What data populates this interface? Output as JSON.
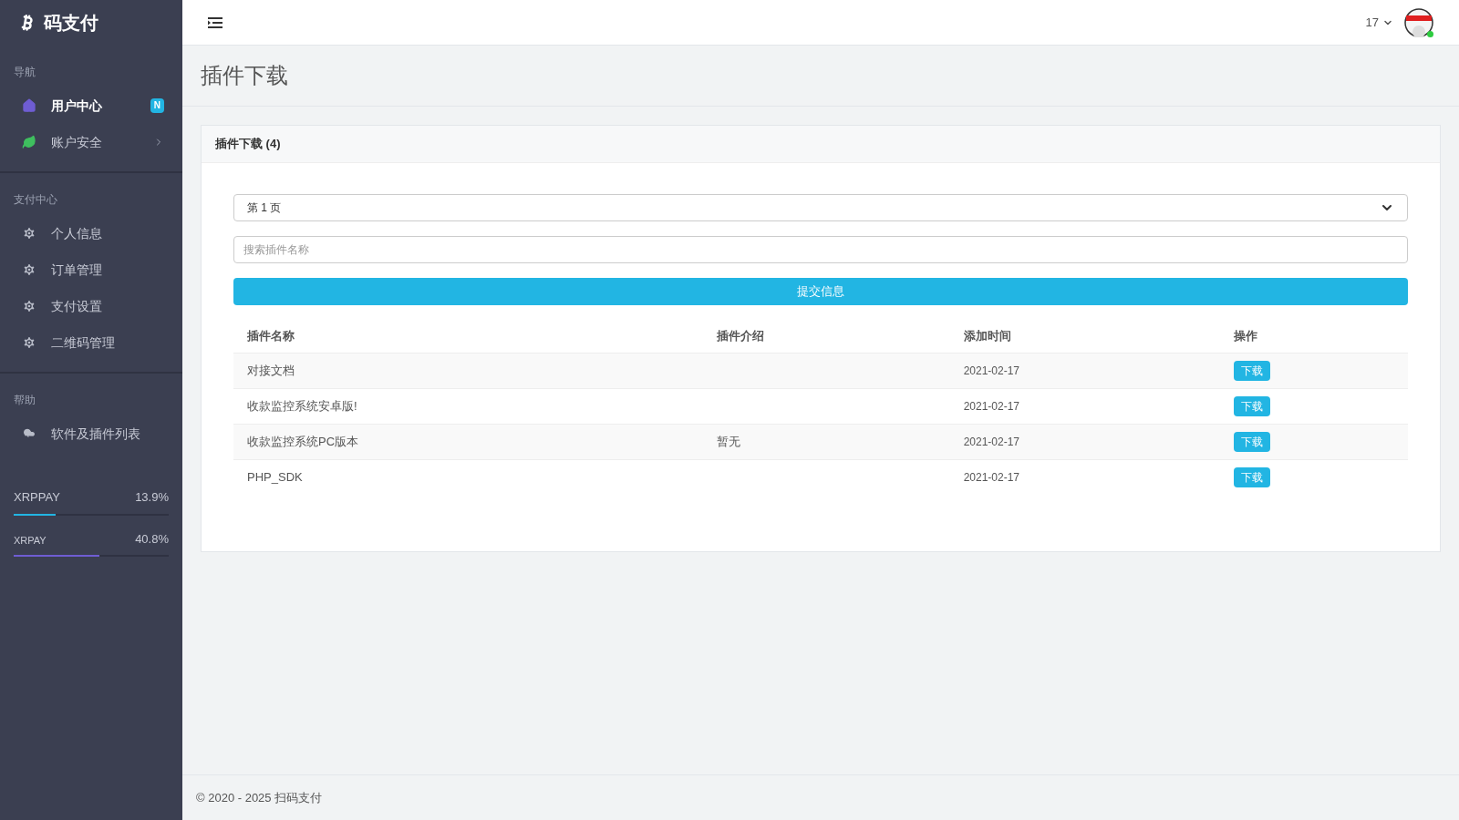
{
  "brand": {
    "name": "码支付"
  },
  "sidebar": {
    "sections": [
      {
        "heading": "导航",
        "items": [
          {
            "kind": "home",
            "label": "用户中心",
            "selected": true,
            "badge": "N"
          },
          {
            "kind": "leaf",
            "label": "账户安全",
            "selected": false,
            "expandable": true
          }
        ]
      },
      {
        "heading": "支付中心",
        "items": [
          {
            "kind": "gear",
            "label": "个人信息",
            "selected": false
          },
          {
            "kind": "gear",
            "label": "订单管理",
            "selected": false
          },
          {
            "kind": "gear",
            "label": "支付设置",
            "selected": false
          },
          {
            "kind": "gear",
            "label": "二维码管理",
            "selected": false
          }
        ]
      },
      {
        "heading": "帮助",
        "items": [
          {
            "kind": "cloud",
            "label": "软件及插件列表",
            "selected": false
          }
        ]
      }
    ],
    "meters": [
      {
        "name": "XRPPAY",
        "reading": "13.9%",
        "level": 0.27,
        "color": "#22b5e3"
      },
      {
        "name": "XRPAY",
        "reading": "40.8%",
        "level": 0.55,
        "color": "#6f5dd3"
      }
    ]
  },
  "topbar": {
    "user": "17",
    "online": true
  },
  "page": {
    "title": "插件下载"
  },
  "card": {
    "title": "插件下载 (4)",
    "page_select": "第 1 页",
    "search": {
      "placeholder": "搜索插件名称"
    },
    "submit": "提交信息",
    "table": {
      "columns": [
        "插件名称",
        "插件介绍",
        "添加时间",
        "操作"
      ],
      "rows": [
        {
          "name": "对接文档",
          "date": "2021-02-17",
          "action": "下载"
        },
        {
          "name": "收款监控系统安卓版!",
          "date": "2021-02-17",
          "action": "下载"
        },
        {
          "name": "收款监控系统PC版本",
          "intro": "暂无",
          "date": "2021-02-17",
          "action": "下载"
        },
        {
          "name": "PHP_SDK",
          "date": "2021-02-17",
          "action": "下载"
        }
      ]
    }
  },
  "footer": "© 2020 - 2025 扫码支付"
}
